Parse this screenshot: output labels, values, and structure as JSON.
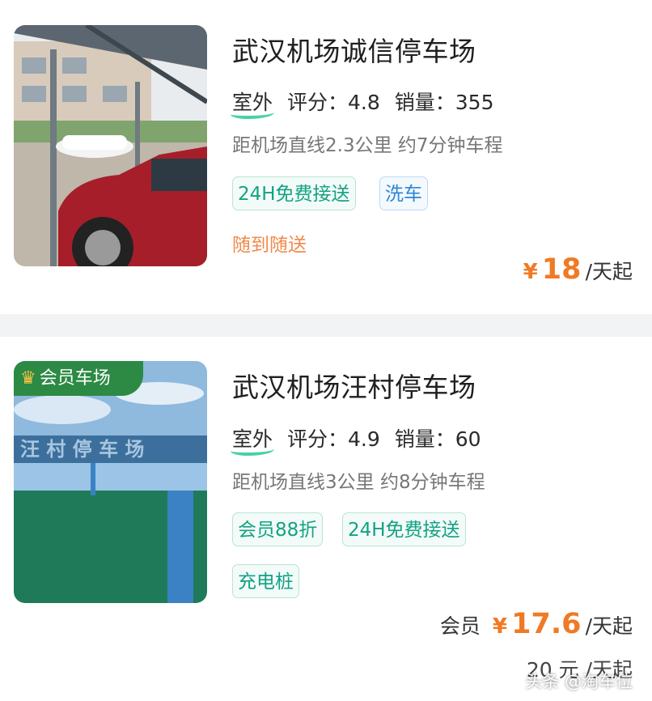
{
  "listings": [
    {
      "title": "武汉机场诚信停车场",
      "type": "室外",
      "rating_label": "评分：4.8",
      "sales_label": "销量：355",
      "distance": "距机场直线2.3公里 约7分钟车程",
      "tags": [
        "24H免费接送",
        "洗车"
      ],
      "promo": "随到随送",
      "price_currency": "¥",
      "price_value": "18",
      "price_unit": "/天起"
    },
    {
      "badge": "会员车场",
      "title": "武汉机场汪村停车场",
      "type": "室外",
      "rating_label": "评分：4.9",
      "sales_label": "销量：60",
      "distance": "距机场直线3公里 约8分钟车程",
      "tags": [
        "会员88折",
        "24H免费接送",
        "充电桩"
      ],
      "member_label": "会员",
      "price_currency": "¥",
      "price_value": "17.6",
      "price_unit": "/天起",
      "original_price": "20 元 /天起"
    }
  ],
  "watermark": "头条 @淘车位",
  "colors": {
    "accent_green": "#13a284",
    "price_orange": "#f07a24",
    "promo_orange": "#f08a4b"
  }
}
